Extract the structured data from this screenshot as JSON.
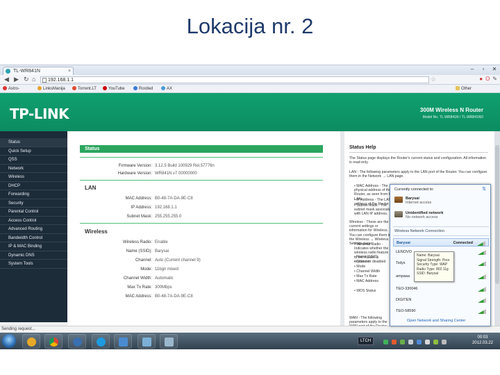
{
  "slide": {
    "title": "Lokacija nr. 2"
  },
  "browser": {
    "tab_title": "TL-WR841N",
    "url": "192.168.1.1",
    "bookmarks": [
      "Astro-Club",
      "LinksManija",
      "Torrent.LT",
      "YouTube",
      "Rostled",
      "AX operacinės siste..."
    ],
    "other_bookmarks": "Other bookmarks"
  },
  "router": {
    "logo": "TP-LINK",
    "product": "300M Wireless N Router",
    "model": "Model No. TL-WR841N / TL-WR841ND",
    "menu": [
      "Status",
      "Quick Setup",
      "QSS",
      "Network",
      "Wireless",
      "DHCP",
      "Forwarding",
      "Security",
      "Parental Control",
      "Access Control",
      "Advanced Routing",
      "Bandwidth Control",
      "IP & MAC Binding",
      "Dynamic DNS",
      "System Tools"
    ],
    "status": {
      "heading": "Status",
      "firmware_label": "Firmware Version:",
      "firmware_value": "3.12.5 Build 100929 Rel.57776n",
      "hardware_label": "Hardware Version:",
      "hardware_value": "WR841N v7 00000000",
      "lan_heading": "LAN",
      "mac_label": "MAC Address:",
      "mac_value": "B0-48-7A-DA-9E-C8",
      "ip_label": "IP Address:",
      "ip_value": "192.168.1.1",
      "mask_label": "Subnet Mask:",
      "mask_value": "255.255.255.0",
      "wireless_heading": "Wireless",
      "radio_label": "Wireless Radio:",
      "radio_value": "Enable",
      "name_label": "Name (SSID):",
      "name_value": "Barysai",
      "channel_label": "Channel:",
      "channel_value": "Auto (Current channel 9)",
      "mode_label": "Mode:",
      "mode_value": "11bgn mixed",
      "width_label": "Channel Width:",
      "width_value": "Automatic",
      "rate_label": "Max Tx Rate:",
      "rate_value": "300Mbps",
      "wmac_label": "MAC Address:",
      "wmac_value": "B0-48-7A-DA-9E-C8"
    },
    "help": {
      "title": "Status Help",
      "p1": "The Status page displays the Router's current status and configuration. All information is read-only.",
      "p2": "LAN - The following parameters apply to the LAN port of the Router. You can configure them in the Network → LAN page.",
      "b1": "• MAC Address - The physical address of the Router, as seen from the LAN.",
      "b2": "• IP Address - The LAN IP address of the Router.",
      "b3": "• Subnet Mask - The subnet mask associated with LAN IP address.",
      "p3": "Wireless - These are the current settings or information for Wireless. You can configure them in the Wireless → Wireless Settings page.",
      "b4": "• Wireless Radio - Indicates whether the wireless radio feature of the Router is enabled or disabled.",
      "b5": "• Name (SSID)",
      "b6": "• Channel",
      "b7": "• Mode",
      "b8": "• Channel Width",
      "b9": "• Max Tx Rate",
      "b10": "• MAC Address",
      "b11": "• WDS Status",
      "p4": "WAN - The following parameters apply to the WAN port of the Router. You can configure them in the Network → WAN page."
    }
  },
  "statusbar": {
    "text": "Sending request..."
  },
  "wifi_popup": {
    "current_label": "Currently connected to:",
    "net1_name": "Barysai",
    "net1_sub": "Internet access",
    "net2_name": "Unidentified network",
    "net2_sub": "No network access",
    "section": "Wireless Network Connection",
    "list": [
      {
        "name": "Barysai",
        "status": "Connected"
      },
      {
        "name": "LENOVO",
        "status": ""
      },
      {
        "name": "Tsilys",
        "status": ""
      },
      {
        "name": "ampaaa",
        "status": ""
      },
      {
        "name": "TEO-330046",
        "status": ""
      },
      {
        "name": "DIGITEN",
        "status": ""
      },
      {
        "name": "TEO-58590",
        "status": ""
      }
    ],
    "link": "Open Network and Sharing Center",
    "tooltip": [
      "Name: Barysai",
      "Signal Strength: Poor",
      "Security Type: WAP",
      "Radio Type: 802.11g",
      "SSID: Barysai"
    ]
  },
  "taskbar": {
    "lang": "LTCH",
    "clock_time": "00:03",
    "clock_date": "2012.03.22"
  },
  "colors": {
    "tp_green": "#0b8c61",
    "section_green": "#2ba55e",
    "sidebar": "#1d2c39"
  }
}
